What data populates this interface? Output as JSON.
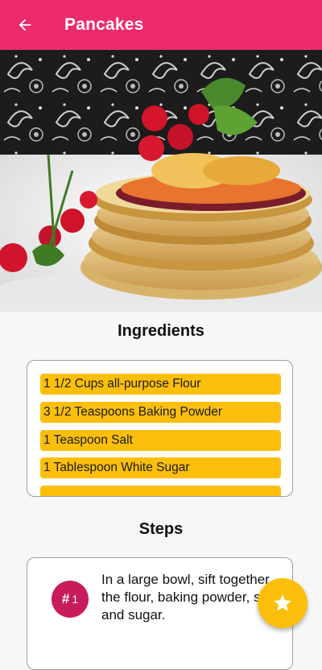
{
  "appbar": {
    "title": "Pancakes",
    "back_icon": "arrow-left-icon",
    "background": "#ee2b6a"
  },
  "hero": {
    "icon": "pancake-photo"
  },
  "ingredients": {
    "title": "Ingredients",
    "items": [
      "1 1/2 Cups all-purpose Flour",
      "3 1/2 Teaspoons Baking Powder",
      "1 Teaspoon Salt",
      "1 Tablespoon White Sugar",
      ""
    ],
    "item_color": "#fbbf0b"
  },
  "steps": {
    "title": "Steps",
    "items": [
      {
        "number": "1",
        "hash": "#",
        "text": "In a large bowl, sift together the flour, baking powder, salt and sugar."
      }
    ],
    "badge_color": "#c81b5c"
  },
  "fab": {
    "icon": "star-icon",
    "color": "#fbbf0b"
  }
}
